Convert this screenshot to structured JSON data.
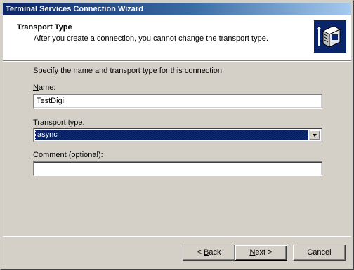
{
  "window": {
    "title": "Terminal Services Connection Wizard"
  },
  "header": {
    "title": "Transport Type",
    "subtitle": "After you create a connection, you cannot change the transport type.",
    "icon": "server-network-icon"
  },
  "form": {
    "instruction": "Specify the name and transport type for this connection.",
    "name_label": {
      "mnemonic": "N",
      "rest": "ame:"
    },
    "name_value": "TestDigi",
    "transport_label": {
      "mnemonic": "T",
      "rest": "ransport type:"
    },
    "transport_value": "async",
    "comment_label": {
      "mnemonic": "C",
      "rest": "omment (optional):"
    },
    "comment_value": ""
  },
  "buttons": {
    "back": {
      "prefix": "< ",
      "mnemonic": "B",
      "rest": "ack"
    },
    "next": {
      "mnemonic": "N",
      "rest": "ext >"
    },
    "cancel": "Cancel"
  },
  "colors": {
    "titlebar_start": "#0a246a",
    "titlebar_end": "#a6caf0",
    "dialog_face": "#d4d0c8",
    "selection": "#0a246a"
  }
}
